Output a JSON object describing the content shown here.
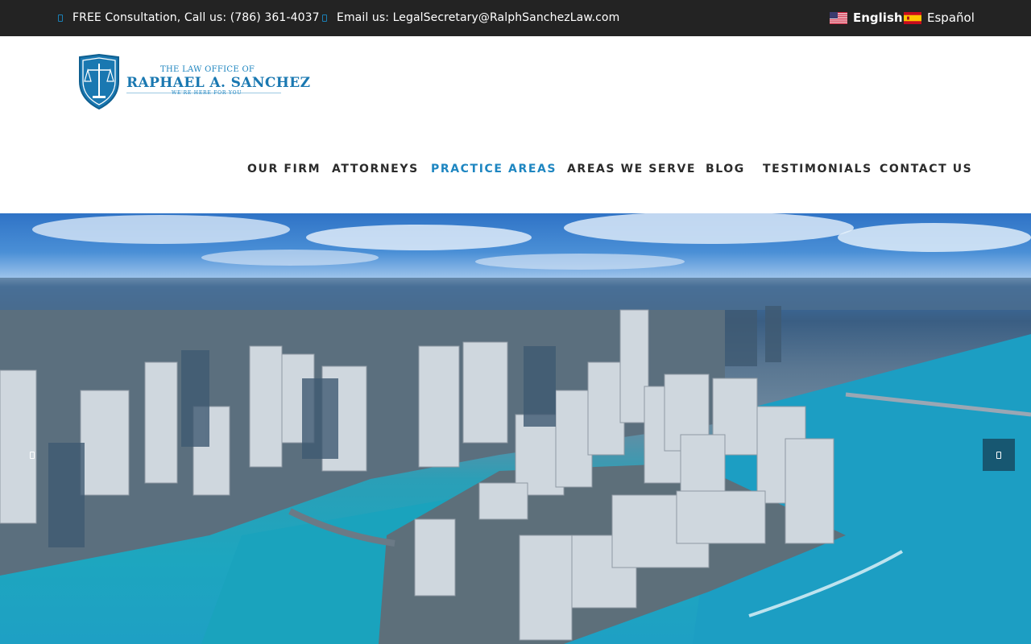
{
  "topbar": {
    "phone_text": "FREE Consultation, Call us: (786) 361-4037",
    "email_text": "Email us: LegalSecretary@RalphSanchezLaw.com",
    "languages": [
      {
        "label": "English",
        "flag": "us-flag-icon"
      },
      {
        "label": "Español",
        "flag": "spain-flag-icon"
      }
    ]
  },
  "logo": {
    "pre": "THE LAW OFFICE OF",
    "name": "RAPHAEL A. SANCHEZ",
    "tag": "WE'RE HERE FOR YOU"
  },
  "nav": {
    "items": [
      {
        "label": "OUR FIRM",
        "active": false
      },
      {
        "label": "ATTORNEYS",
        "active": false
      },
      {
        "label": "PRACTICE AREAS",
        "active": true
      },
      {
        "label": "AREAS WE SERVE",
        "active": false
      },
      {
        "label": "BLOG",
        "active": false
      },
      {
        "label": "TESTIMONIALS",
        "active": false
      },
      {
        "label": "CONTACT US",
        "active": false
      }
    ]
  },
  "colors": {
    "topbar_bg": "#232323",
    "brand_blue": "#1e86c1",
    "nav_text": "#2b2b2b"
  },
  "hero": {
    "image": "aerial-city-skyline-image",
    "prev_icon": "chevron-left-icon",
    "next_icon": "chevron-right-icon"
  }
}
